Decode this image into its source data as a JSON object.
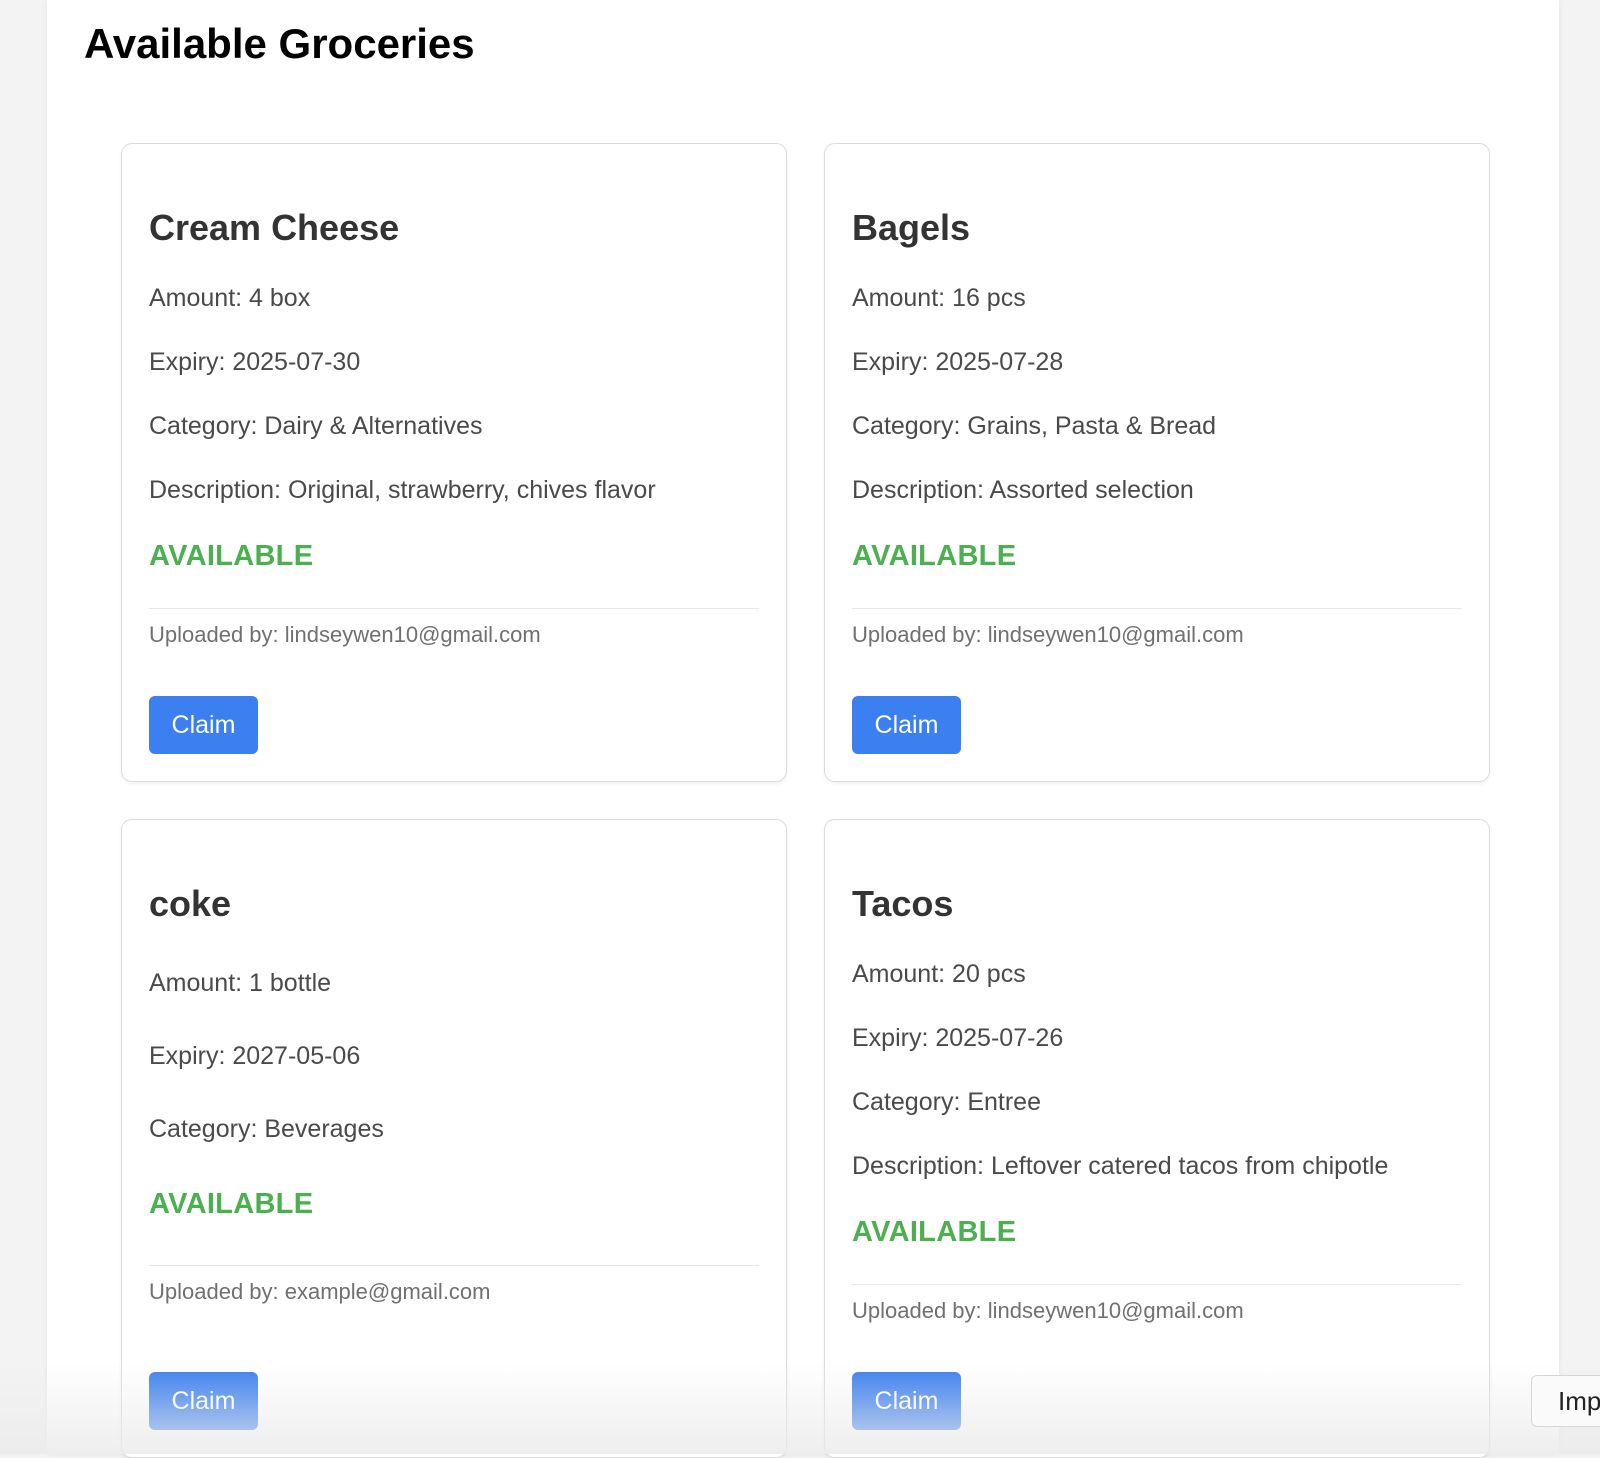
{
  "page": {
    "title": "Available Groceries"
  },
  "colors": {
    "status_available": "#4caf50",
    "claim_button": "#3b7ff0"
  },
  "items": [
    {
      "name": "Cream Cheese",
      "amount": "Amount: 4 box",
      "expiry": "Expiry: 2025-07-30",
      "category": "Category: Dairy & Alternatives",
      "description": "Description: Original, strawberry, chives flavor",
      "status": "AVAILABLE",
      "uploaded_by": "Uploaded by: lindseywen10@gmail.com",
      "claim_label": "Claim"
    },
    {
      "name": "Bagels",
      "amount": "Amount: 16 pcs",
      "expiry": "Expiry: 2025-07-28",
      "category": "Category: Grains, Pasta & Bread",
      "description": "Description: Assorted selection",
      "status": "AVAILABLE",
      "uploaded_by": "Uploaded by: lindseywen10@gmail.com",
      "claim_label": "Claim"
    },
    {
      "name": "coke",
      "amount": "Amount: 1 bottle",
      "expiry": "Expiry: 2027-05-06",
      "category": "Category: Beverages",
      "status": "AVAILABLE",
      "uploaded_by": "Uploaded by: example@gmail.com",
      "claim_label": "Claim"
    },
    {
      "name": "Tacos",
      "amount": "Amount: 20 pcs",
      "expiry": "Expiry: 2025-07-26",
      "category": "Category: Entree",
      "description": "Description: Leftover catered tacos from chipotle",
      "status": "AVAILABLE",
      "uploaded_by": "Uploaded by: lindseywen10@gmail.com",
      "claim_label": "Claim"
    }
  ],
  "floating_button": {
    "label": "Imp"
  }
}
